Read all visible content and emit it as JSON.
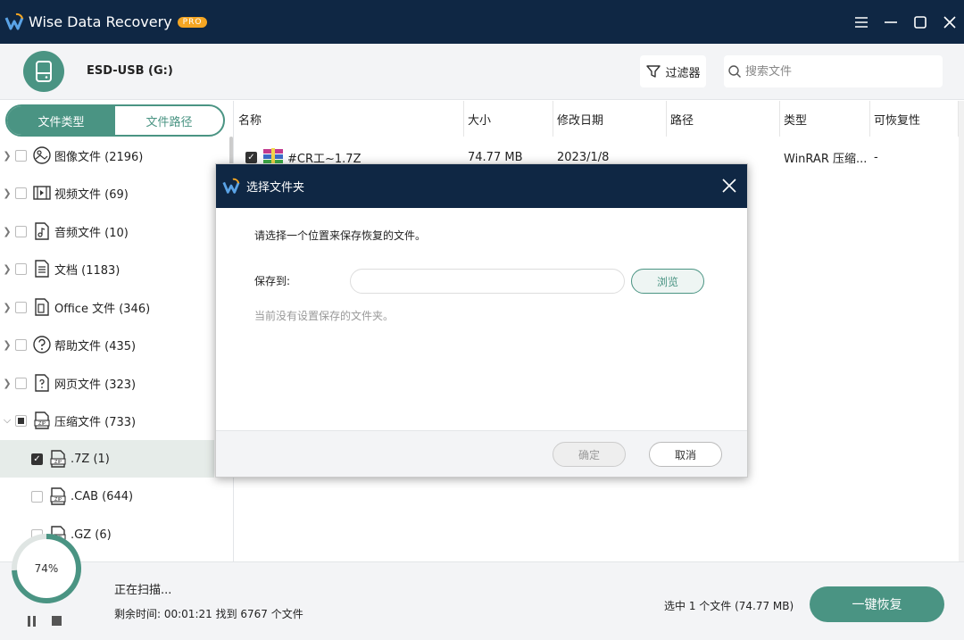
{
  "app": {
    "title": "Wise Data Recovery",
    "badge": "PRO"
  },
  "colors": {
    "titlebar": "#0f2744",
    "accent": "#4a9483",
    "pro_badge": "#f5a623"
  },
  "window_controls": [
    "menu-icon",
    "minimize-icon",
    "maximize-icon",
    "close-icon"
  ],
  "drive": {
    "name": "ESD-USB (G:)",
    "icon": "usb-drive-icon"
  },
  "toolbar": {
    "filter_label": "过滤器",
    "search_placeholder": "搜索文件"
  },
  "sidebar": {
    "tabs": [
      {
        "label": "文件类型",
        "active": true
      },
      {
        "label": "文件路径",
        "active": false
      }
    ],
    "items": [
      {
        "label": "图像文件 (2196)",
        "icon": "image-icon"
      },
      {
        "label": "视频文件 (69)",
        "icon": "video-icon"
      },
      {
        "label": "音频文件 (10)",
        "icon": "audio-icon"
      },
      {
        "label": "文档 (1183)",
        "icon": "document-icon"
      },
      {
        "label": "Office 文件 (346)",
        "icon": "office-icon"
      },
      {
        "label": "帮助文件 (435)",
        "icon": "help-icon"
      },
      {
        "label": "网页文件 (323)",
        "icon": "webpage-icon"
      },
      {
        "label": "压缩文件 (733)",
        "icon": "zip-icon"
      },
      {
        "label": ".7Z (1)",
        "icon": "zip-icon"
      },
      {
        "label": ".CAB (644)",
        "icon": "zip-icon"
      },
      {
        "label": ".GZ (6)",
        "icon": "zip-icon"
      }
    ]
  },
  "table": {
    "headers": [
      "名称",
      "大小",
      "修改日期",
      "路径",
      "类型",
      "可恢复性"
    ],
    "rows": [
      {
        "name": "#CR工~1.7Z",
        "size": "74.77 MB",
        "date": "2023/1/8",
        "path": "",
        "type": "WinRAR 压缩...",
        "recoverability": "-"
      }
    ]
  },
  "progress": {
    "percent_label": "74%",
    "percent": 74,
    "status": "正在扫描...",
    "detail": "剩余时间: 00:01:21 找到 6767 个文件"
  },
  "footer": {
    "selected_info": "选中 1 个文件 (74.77 MB)",
    "recover_label": "一键恢复"
  },
  "dialog": {
    "title": "选择文件夹",
    "prompt": "请选择一个位置来保存恢复的文件。",
    "save_label": "保存到:",
    "path_value": "",
    "browse_label": "浏览",
    "note": "当前没有设置保存的文件夹。",
    "ok_label": "确定",
    "cancel_label": "取消"
  }
}
